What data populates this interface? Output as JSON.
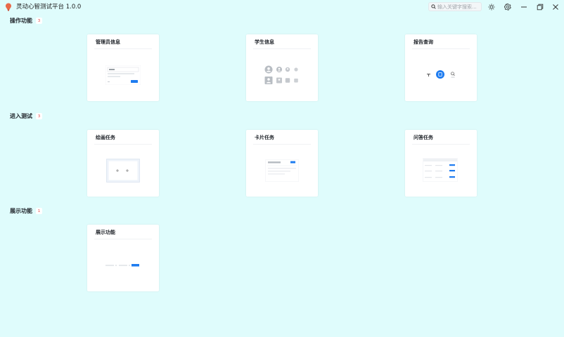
{
  "app": {
    "title": "灵动心智测试平台 1.0.0",
    "search_placeholder": "输入关键字搜索..."
  },
  "colors": {
    "background": "#dffcfc",
    "accent": "#1e7cf0",
    "badge_text": "#e34d4d"
  },
  "sections": [
    {
      "title": "操作功能",
      "count": "3",
      "cards": [
        {
          "title": "管理员信息"
        },
        {
          "title": "学生信息"
        },
        {
          "title": "报告查询"
        }
      ]
    },
    {
      "title": "进入测试",
      "count": "3",
      "cards": [
        {
          "title": "绘画任务"
        },
        {
          "title": "卡片任务"
        },
        {
          "title": "问答任务"
        }
      ]
    },
    {
      "title": "展示功能",
      "count": "1",
      "cards": [
        {
          "title": "展示功能"
        }
      ]
    }
  ]
}
